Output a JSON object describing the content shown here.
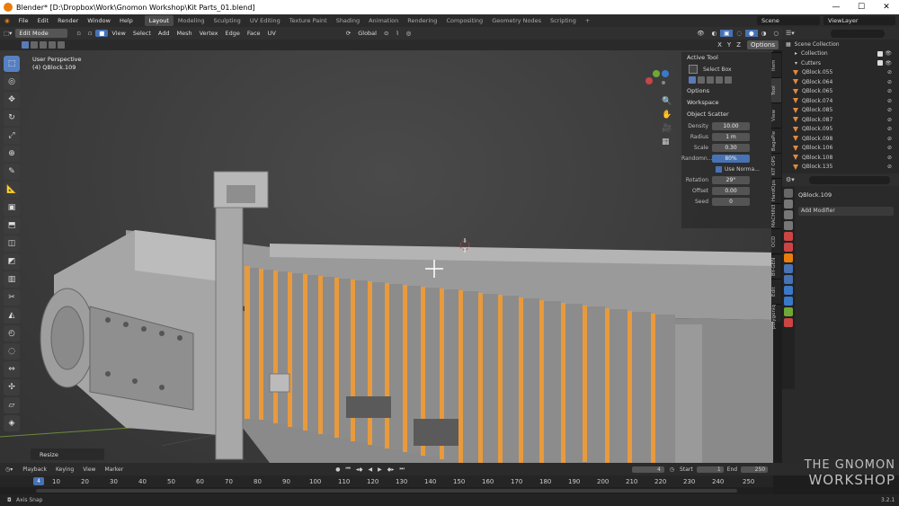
{
  "title_bar": {
    "text": "Blender* [D:\\Dropbox\\Work\\Gnomon Workshop\\Kit Parts_01.blend]"
  },
  "menu": [
    "File",
    "Edit",
    "Render",
    "Window",
    "Help"
  ],
  "workspaces": [
    "Layout",
    "Modeling",
    "Sculpting",
    "UV Editing",
    "Texture Paint",
    "Shading",
    "Animation",
    "Rendering",
    "Compositing",
    "Geometry Nodes",
    "Scripting"
  ],
  "scene_label": "Scene",
  "viewlayer_label": "ViewLayer",
  "header": {
    "mode": "Edit Mode",
    "items": [
      "View",
      "Select",
      "Add",
      "Mesh",
      "Vertex",
      "Edge",
      "Face",
      "UV"
    ],
    "transform_orientation": "Global",
    "options_label": "Options"
  },
  "viewport": {
    "view_name": "User Perspective",
    "object_name": "(4) QBlock.109",
    "operator_panel": "Resize"
  },
  "n_panel": {
    "active_tool_header": "Active Tool",
    "active_tool_name": "Select Box",
    "options_header": "Options",
    "workspace_header": "Workspace",
    "object_scatter_header": "Object Scatter",
    "fields": [
      {
        "label": "Density",
        "value": "10.00"
      },
      {
        "label": "Radius",
        "value": "1 m"
      },
      {
        "label": "Scale",
        "value": "0.30"
      },
      {
        "label": "Randomn...",
        "value": "80%"
      }
    ],
    "use_normal_label": "Use Norma...",
    "fields2": [
      {
        "label": "Rotation",
        "value": "29°"
      },
      {
        "label": "Offset",
        "value": "0.00"
      },
      {
        "label": "Seed",
        "value": "0"
      }
    ],
    "tabs": [
      "Item",
      "Tool",
      "View",
      "BagaPie",
      "KIT OPS",
      "HardOps",
      "MACHIN3",
      "OCD",
      "BY-GEN",
      "Edit",
      "polygoniq"
    ]
  },
  "outliner": {
    "scene_collection": "Scene Collection",
    "collection": "Collection",
    "cutters": "Cutters",
    "items": [
      "QBlock.055",
      "QBlock.064",
      "QBlock.065",
      "QBlock.074",
      "QBlock.085",
      "QBlock.087",
      "QBlock.095",
      "QBlock.098",
      "QBlock.106",
      "QBlock.108",
      "QBlock.135"
    ]
  },
  "properties": {
    "object_name": "QBlock.109",
    "add_modifier_label": "Add Modifier"
  },
  "timeline": {
    "menu": [
      "Playback",
      "Keying",
      "View",
      "Marker"
    ],
    "current_frame": "4",
    "start_label": "Start",
    "start_value": "1",
    "end_label": "End",
    "end_value": "250",
    "ruler": [
      "4",
      "10",
      "20",
      "30",
      "40",
      "50",
      "60",
      "70",
      "80",
      "90",
      "100",
      "110",
      "120",
      "130",
      "140",
      "150",
      "160",
      "170",
      "180",
      "190",
      "200",
      "210",
      "220",
      "230",
      "240",
      "250"
    ]
  },
  "status": {
    "left": "Axis Snap",
    "version": "3.2.1"
  },
  "watermark": {
    "line1": "THE GNOMON",
    "line2": "WORKSHOP"
  },
  "colors": {
    "accent": "#4772b3",
    "edit_highlight": "#e89a3c",
    "background": "#3b3b3b"
  }
}
